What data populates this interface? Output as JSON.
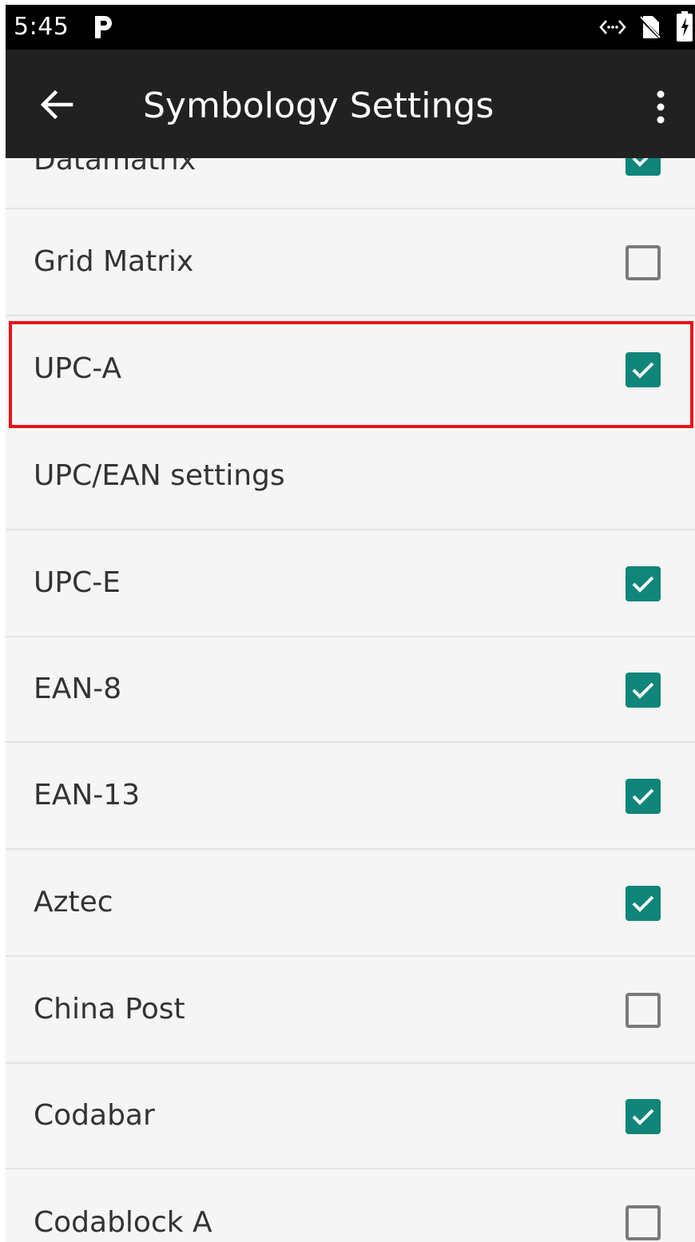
{
  "status_bar": {
    "time": "5:45"
  },
  "app_bar": {
    "title": "Symbology Settings",
    "back_icon": "arrow-left-icon",
    "menu_icon": "more-vert-icon"
  },
  "colors": {
    "accent": "#10857a",
    "app_bar": "#212121",
    "highlight": "#e8141b"
  },
  "items": [
    {
      "label": "Datamatrix",
      "checked": true,
      "has_checkbox": true
    },
    {
      "label": "Grid Matrix",
      "checked": false,
      "has_checkbox": true
    },
    {
      "label": "UPC-A",
      "checked": true,
      "has_checkbox": true
    },
    {
      "label": "UPC/EAN settings",
      "checked": false,
      "has_checkbox": false
    },
    {
      "label": "UPC-E",
      "checked": true,
      "has_checkbox": true
    },
    {
      "label": "EAN-8",
      "checked": true,
      "has_checkbox": true
    },
    {
      "label": "EAN-13",
      "checked": true,
      "has_checkbox": true
    },
    {
      "label": "Aztec",
      "checked": true,
      "has_checkbox": true
    },
    {
      "label": "China Post",
      "checked": false,
      "has_checkbox": true
    },
    {
      "label": "Codabar",
      "checked": true,
      "has_checkbox": true
    },
    {
      "label": "Codablock A",
      "checked": false,
      "has_checkbox": true
    }
  ]
}
